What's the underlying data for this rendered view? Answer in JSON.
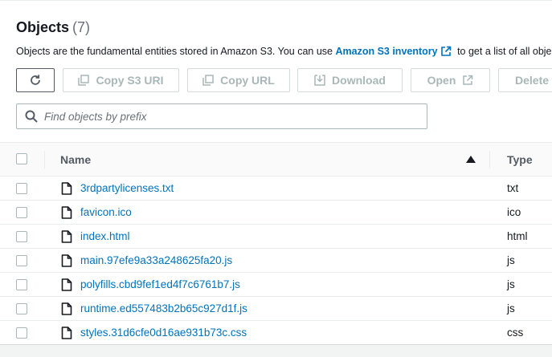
{
  "header": {
    "title": "Objects",
    "count": "(7)"
  },
  "description": {
    "before_link": "Objects are the fundamental entities stored in Amazon S3. You can use ",
    "link": "Amazon S3 inventory",
    "after_link": " to get a list of all objects"
  },
  "toolbar": {
    "refresh_icon": "refresh-icon",
    "copy_s3_uri": "Copy S3 URI",
    "copy_url": "Copy URL",
    "download": "Download",
    "open": "Open",
    "delete": "Delete"
  },
  "search": {
    "placeholder": "Find objects by prefix",
    "value": ""
  },
  "table": {
    "columns": {
      "name": "Name",
      "type": "Type"
    },
    "sort": {
      "column": "Name",
      "direction": "ascending"
    },
    "rows": [
      {
        "name": "3rdpartylicenses.txt",
        "type": "txt"
      },
      {
        "name": "favicon.ico",
        "type": "ico"
      },
      {
        "name": "index.html",
        "type": "html"
      },
      {
        "name": "main.97efe9a33a248625fa20.js",
        "type": "js"
      },
      {
        "name": "polyfills.cbd9fef1ed4f7c6761b7.js",
        "type": "js"
      },
      {
        "name": "runtime.ed557483b2b65c927d1f.js",
        "type": "js"
      },
      {
        "name": "styles.31d6cfe0d16ae931b73c.css",
        "type": "css"
      }
    ]
  },
  "colors": {
    "link": "#0073bb",
    "text": "#16191f",
    "disabled": "#aab7b8"
  }
}
